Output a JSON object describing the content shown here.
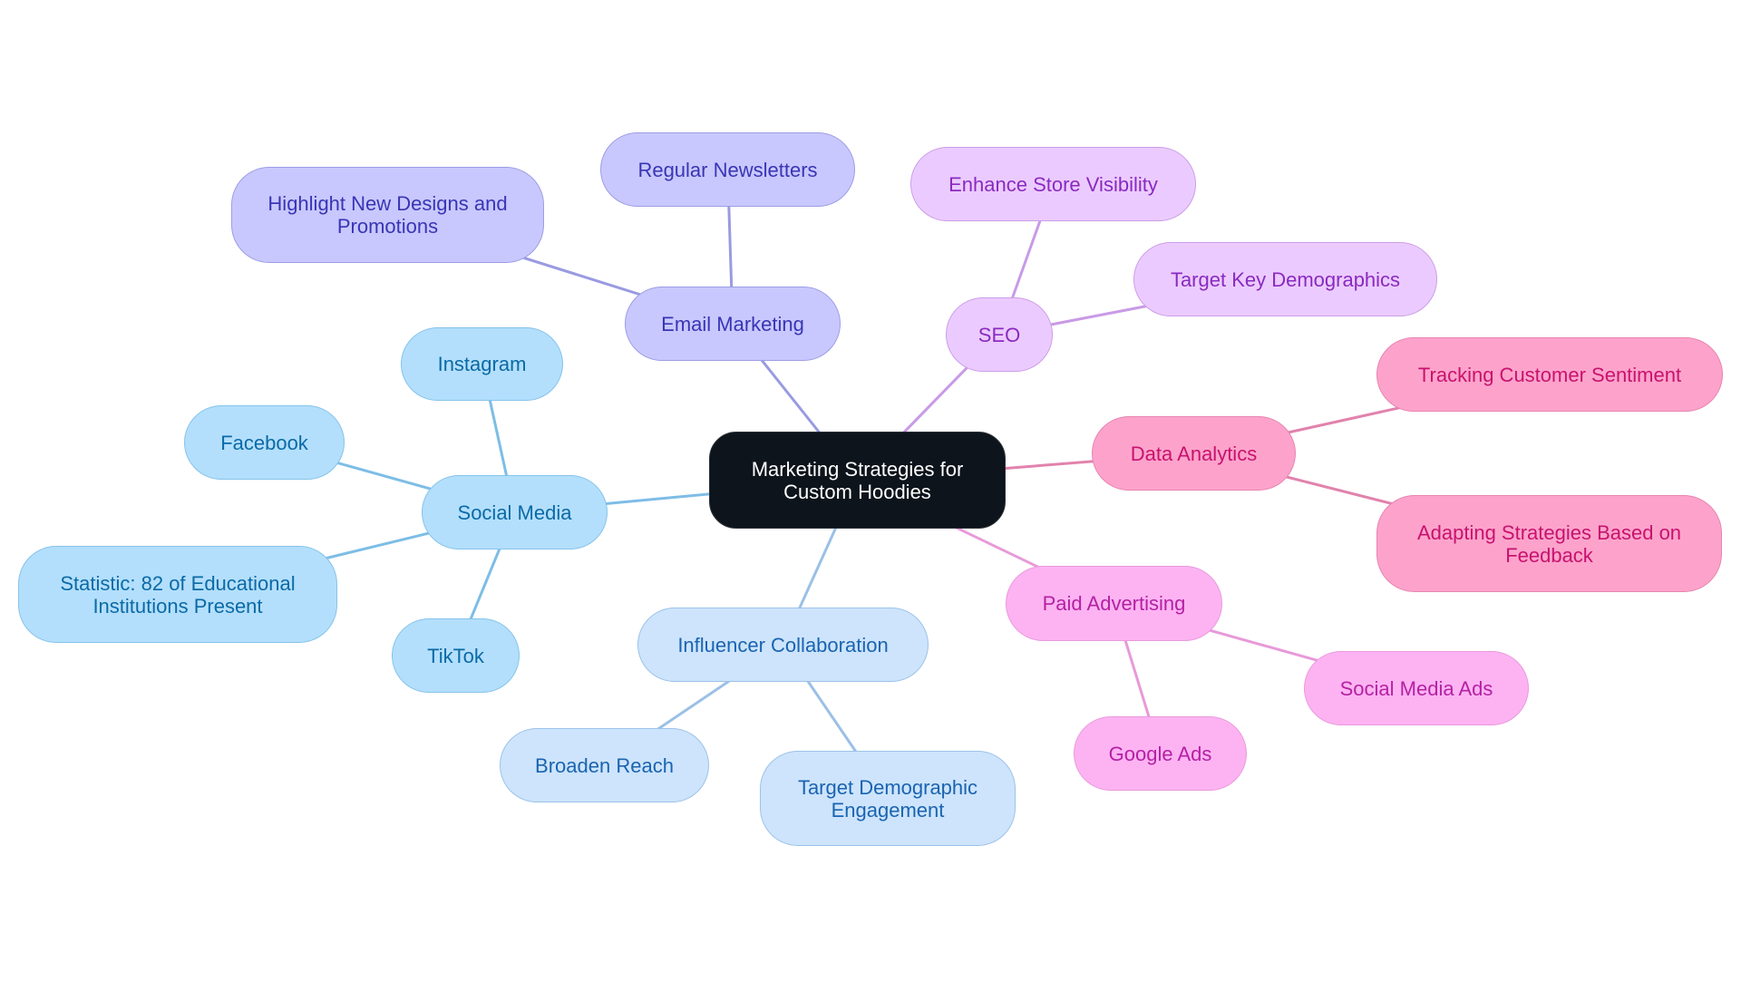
{
  "title": "Marketing Strategies for Custom Hoodies",
  "colors": {
    "root": "#0d141b",
    "social": "#7dbde6",
    "email": "#9a9ae2",
    "seo": "#c99ae6",
    "data": "#e282ad",
    "paid": "#e89ad9",
    "influencer": "#9bc0e6"
  },
  "root": {
    "label": "Marketing Strategies for Custom Hoodies"
  },
  "branches": [
    {
      "id": "social",
      "label": "Social Media",
      "children": [
        "Instagram",
        "Facebook",
        "Statistic: 82 of Educational Institutions Present",
        "TikTok"
      ]
    },
    {
      "id": "email",
      "label": "Email Marketing",
      "children": [
        "Regular Newsletters",
        "Highlight New Designs and Promotions"
      ]
    },
    {
      "id": "seo",
      "label": "SEO",
      "children": [
        "Enhance Store Visibility",
        "Target Key Demographics"
      ]
    },
    {
      "id": "data",
      "label": "Data Analytics",
      "children": [
        "Tracking Customer Sentiment",
        "Adapting Strategies Based on Feedback"
      ]
    },
    {
      "id": "paid",
      "label": "Paid Advertising",
      "children": [
        "Social Media Ads",
        "Google Ads"
      ]
    },
    {
      "id": "influencer",
      "label": "Influencer Collaboration",
      "children": [
        "Broaden Reach",
        "Target Demographic Engagement"
      ]
    }
  ]
}
